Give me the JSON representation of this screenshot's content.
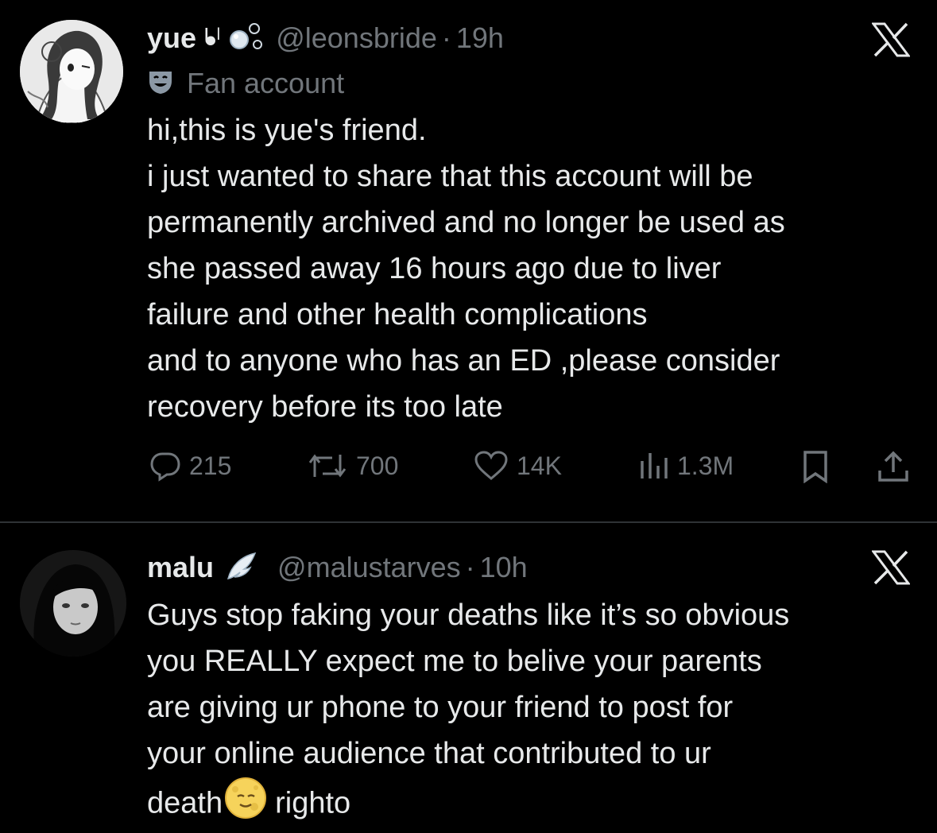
{
  "tweets": [
    {
      "name": "yue",
      "name_glyphs": "ᖲˡ",
      "handle": "@leonsbride",
      "separator": "·",
      "time": "19h",
      "label": "Fan account",
      "label_icon": "theater-mask-icon",
      "body_lines": [
        "hi,this is yue's friend.",
        "i just wanted to share that this account will be",
        "permanently archived and no longer be used as",
        "she passed away 16 hours ago due to liver",
        "failure and other health complications",
        "and to anyone who has an ED ,please consider",
        "recovery before its too late"
      ],
      "actions": {
        "replies": "215",
        "reposts": "700",
        "likes": "14K",
        "views": "1.3M"
      }
    },
    {
      "name": "malu",
      "handle": "@malustarves",
      "separator": "·",
      "time": "10h",
      "name_icon": "wing-icon",
      "body_lines": [
        "Guys stop faking your deaths like it’s so obvious",
        "you REALLY expect me to belive your parents",
        "are giving ur phone to your friend to post for",
        "your online audience that contributed to ur"
      ],
      "last_line_before": "death",
      "last_line_emoji": "full-moon-face-icon",
      "last_line_after": "righto"
    }
  ],
  "colors": {
    "background": "#000000",
    "text": "#e7e9ea",
    "muted": "#71767b",
    "divider": "#2f3336"
  }
}
